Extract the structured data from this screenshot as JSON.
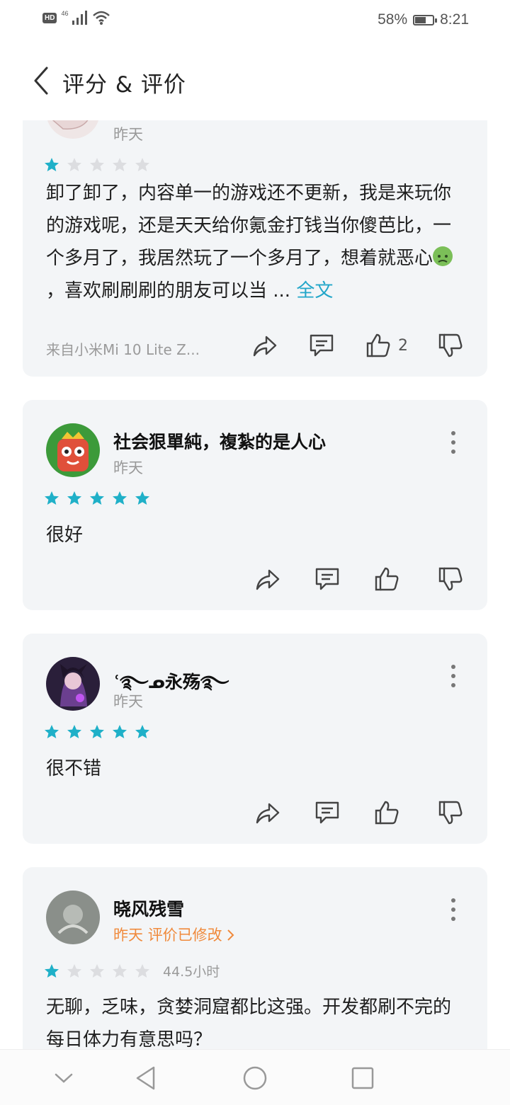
{
  "status_bar": {
    "hd": "HD",
    "network": "46",
    "battery_percent": "58%",
    "battery_level": 0.58,
    "time": "8:21",
    "icons": [
      "signal-icon",
      "wifi-icon",
      "battery-icon"
    ]
  },
  "header": {
    "back_icon": "chevron-left-icon",
    "title": "评分 & 评价"
  },
  "colors": {
    "star_filled": "#1fb0c8",
    "star_empty": "#dcdde0",
    "link": "#22a6c9",
    "edited": "#f08a3c",
    "card_bg": "#f3f5f7"
  },
  "reviews": [
    {
      "username": "",
      "time": "昨天",
      "rating": 1,
      "text": "卸了卸了，内容单一的游戏还不更新，我是来玩你的游戏呢，还是天天给你氪金打钱当你傻芭比，一个多月了，我居然玩了一个多月了，想着就恶心",
      "text_after_emoji": "，喜欢刷刷刷的朋友可以当 ...",
      "more_link": "全文",
      "device": "来自小米Mi 10 Lite Z...",
      "likes": "2"
    },
    {
      "username": "社会狠單純，複紮的是人心",
      "time": "昨天",
      "rating": 5,
      "text": "很好"
    },
    {
      "username": "ʿ࿐ᓄ永殇࿐",
      "time": "昨天",
      "rating": 5,
      "text": "很不错"
    },
    {
      "username": "晓风残雪",
      "time": "昨天",
      "edited_label": "评价已修改",
      "rating": 1,
      "playtime": "44.5小时",
      "text": "无聊，乏味，贪婪洞窟都比这强。开发都刷不完的每日体力有意思吗？"
    }
  ],
  "nav": {
    "icons": [
      "chevron-down-icon",
      "back-triangle-icon",
      "home-circle-icon",
      "recents-square-icon"
    ]
  }
}
